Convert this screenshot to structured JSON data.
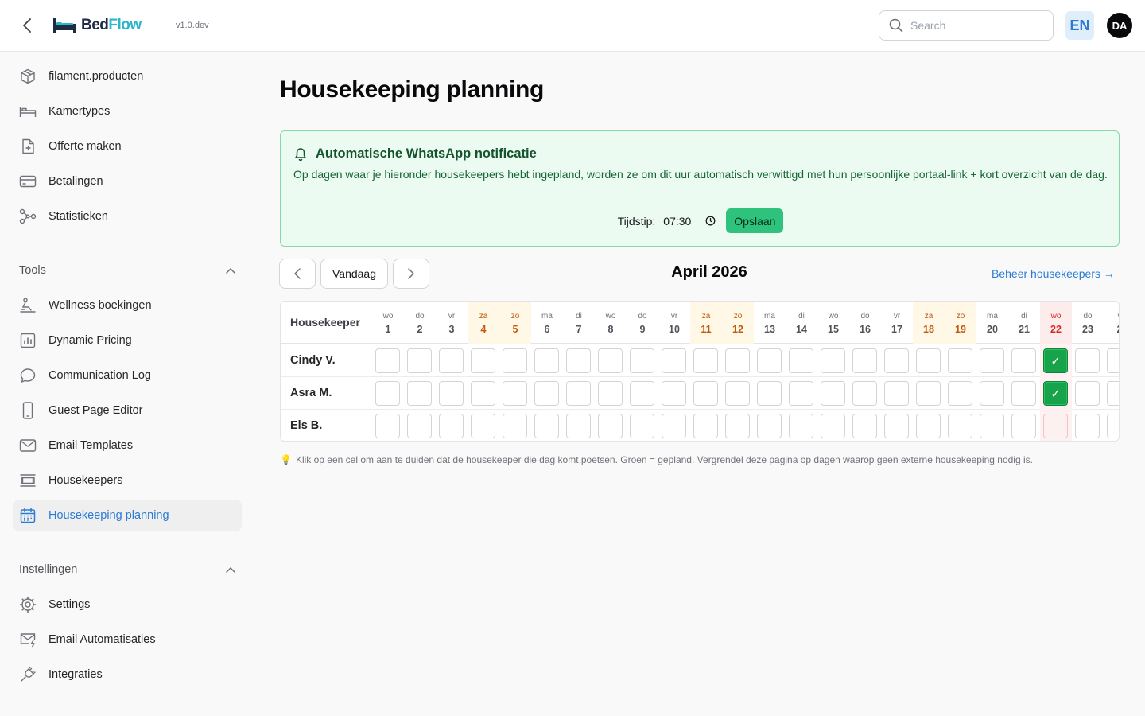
{
  "app": {
    "brand_part1": "Bed",
    "brand_part2": "Flow",
    "version": "v1.0.dev"
  },
  "header": {
    "search_placeholder": "Search",
    "language": "EN",
    "user_initials": "DA"
  },
  "sidebar": {
    "items_top": [
      {
        "label": "filament.producten",
        "icon": "package-icon"
      },
      {
        "label": "Kamertypes",
        "icon": "bed-icon"
      },
      {
        "label": "Offerte maken",
        "icon": "document-plus-icon"
      },
      {
        "label": "Betalingen",
        "icon": "credit-card-icon"
      },
      {
        "label": "Statistieken",
        "icon": "share-nodes-icon"
      }
    ],
    "tools_label": "Tools",
    "tools": [
      {
        "label": "Wellness boekingen",
        "icon": "wellness-icon"
      },
      {
        "label": "Dynamic Pricing",
        "icon": "bar-chart-icon"
      },
      {
        "label": "Communication Log",
        "icon": "chat-bubble-icon"
      },
      {
        "label": "Guest Page Editor",
        "icon": "phone-icon"
      },
      {
        "label": "Email Templates",
        "icon": "envelope-icon"
      },
      {
        "label": "Housekeepers",
        "icon": "list-frame-icon"
      },
      {
        "label": "Housekeeping planning",
        "icon": "calendar-icon",
        "active": true
      }
    ],
    "settings_label": "Instellingen",
    "settings": [
      {
        "label": "Settings",
        "icon": "cog-icon"
      },
      {
        "label": "Email Automatisaties",
        "icon": "envelope-bolt-icon"
      },
      {
        "label": "Integraties",
        "icon": "plug-icon"
      }
    ]
  },
  "page": {
    "title": "Housekeeping planning"
  },
  "notice": {
    "title": "Automatische WhatsApp notificatie",
    "body": "Op dagen waar je hieronder housekeepers hebt ingepland, worden ze om dit uur automatisch verwittigd met hun persoonlijke portaal-link + kort overzicht van de dag.",
    "time_label": "Tijdstip:",
    "time_value": "07:30",
    "save_label": "Opslaan"
  },
  "calendar": {
    "today_label": "Vandaag",
    "month": "April 2026",
    "manage_link": "Beheer housekeepers →",
    "column_header": "Housekeeper",
    "days": [
      {
        "dn": "wo",
        "dd": "1"
      },
      {
        "dn": "do",
        "dd": "2"
      },
      {
        "dn": "vr",
        "dd": "3"
      },
      {
        "dn": "za",
        "dd": "4",
        "weekend": true
      },
      {
        "dn": "zo",
        "dd": "5",
        "weekend": true
      },
      {
        "dn": "ma",
        "dd": "6"
      },
      {
        "dn": "di",
        "dd": "7"
      },
      {
        "dn": "wo",
        "dd": "8"
      },
      {
        "dn": "do",
        "dd": "9"
      },
      {
        "dn": "vr",
        "dd": "10"
      },
      {
        "dn": "za",
        "dd": "11",
        "weekend": true
      },
      {
        "dn": "zo",
        "dd": "12",
        "weekend": true
      },
      {
        "dn": "ma",
        "dd": "13"
      },
      {
        "dn": "di",
        "dd": "14"
      },
      {
        "dn": "wo",
        "dd": "15"
      },
      {
        "dn": "do",
        "dd": "16"
      },
      {
        "dn": "vr",
        "dd": "17"
      },
      {
        "dn": "za",
        "dd": "18",
        "weekend": true
      },
      {
        "dn": "zo",
        "dd": "19",
        "weekend": true
      },
      {
        "dn": "ma",
        "dd": "20"
      },
      {
        "dn": "di",
        "dd": "21"
      },
      {
        "dn": "wo",
        "dd": "22",
        "today": true
      },
      {
        "dn": "do",
        "dd": "23"
      },
      {
        "dn": "v",
        "dd": "2"
      }
    ],
    "housekeepers": [
      {
        "name": "Cindy V.",
        "planned": [
          "22"
        ]
      },
      {
        "name": "Asra M.",
        "planned": [
          "22"
        ]
      },
      {
        "name": "Els B.",
        "planned": []
      }
    ],
    "check_mark": "✓",
    "hint_icon": "💡",
    "hint": "Klik op een cel om aan te duiden dat de housekeeper die dag komt poetsen. Groen = gepland. Vergrendel deze pagina op dagen waarop geen externe housekeeping nodig is."
  },
  "colors": {
    "accent": "#2b7bd3",
    "planned": "#16a34a",
    "weekend": "#c2570c",
    "today": "#dc2626",
    "notice_bg": "#ebfbf1"
  }
}
